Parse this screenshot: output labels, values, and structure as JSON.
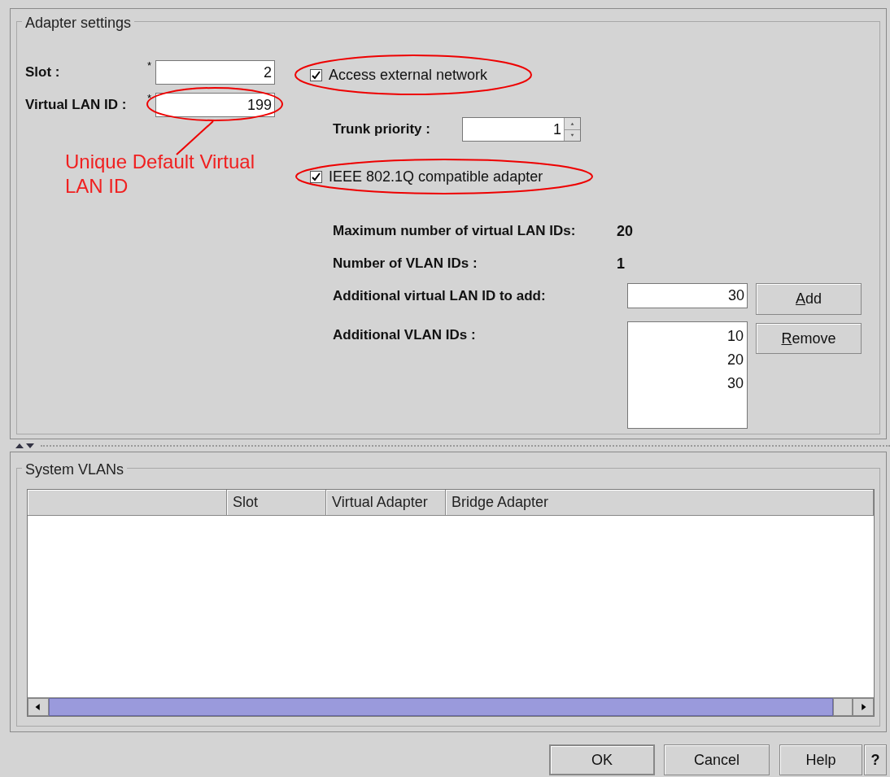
{
  "adapter_settings": {
    "title": "Adapter settings",
    "slot": {
      "label": "Slot :",
      "required": "*",
      "value": "2"
    },
    "vlan_id": {
      "label": "Virtual LAN ID :",
      "required": "*",
      "value": "199"
    },
    "access_external": {
      "label": "Access external network",
      "checked": true
    },
    "trunk_priority": {
      "label": "Trunk priority :",
      "value": "1"
    },
    "ieee": {
      "label": "IEEE 802.1Q compatible adapter",
      "checked": true
    },
    "max_ids": {
      "label": "Maximum number of virtual LAN IDs:",
      "value": "20"
    },
    "num_ids": {
      "label": "Number of VLAN IDs :",
      "value": "1"
    },
    "add_id": {
      "label": "Additional virtual LAN ID to add:",
      "value": "30",
      "button": {
        "mnemonic": "A",
        "rest": "dd"
      }
    },
    "additional_ids": {
      "label": "Additional VLAN IDs :",
      "items": [
        "10",
        "20",
        "30"
      ],
      "button": {
        "mnemonic": "R",
        "rest": "emove"
      }
    }
  },
  "annotation": {
    "callout": "Unique Default Virtual LAN ID"
  },
  "system_vlans": {
    "title": "System VLANs",
    "columns": [
      "Slot",
      "Virtual Adapter",
      "Bridge Adapter"
    ]
  },
  "buttons": [
    "OK",
    "Cancel",
    "Help",
    "?"
  ]
}
